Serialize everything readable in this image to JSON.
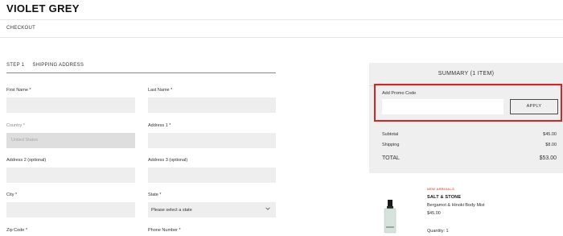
{
  "header": {
    "logo": "VIOLET GREY"
  },
  "subheader": {
    "label": "CHECKOUT"
  },
  "step": {
    "number": "STEP 1",
    "title": "SHIPPING ADDRESS"
  },
  "form": {
    "first_name_label": "First Name *",
    "last_name_label": "Last Name *",
    "country_label": "Country *",
    "country_value": "United States",
    "address1_label": "Address 1 *",
    "address2_label": "Address 2 (optional)",
    "address3_label": "Address 3 (optional)",
    "city_label": "City *",
    "state_label": "State *",
    "state_value": "Please select a state",
    "zip_label": "Zip Code *",
    "phone_label": "Phone Number *"
  },
  "summary": {
    "title": "SUMMARY (1 ITEM)",
    "promo_label": "Add Promo Code",
    "promo_value": "",
    "apply_label": "APPLY",
    "subtotal_label": "Subtotal",
    "subtotal_value": "$45.00",
    "shipping_label": "Shipping",
    "shipping_value": "$8.00",
    "total_label": "TOTAL",
    "total_value": "$53.00"
  },
  "product": {
    "badge": "NEW ARRIVALS",
    "brand": "SALT & STONE",
    "name": "Bergamot & Hinoki Body Mist",
    "price": "$45.00",
    "quantity": "Quantity: 1",
    "icon": "bottle-icon"
  },
  "colors": {
    "accent_red": "#d92323",
    "field_bg": "#eeeeee",
    "summary_bg": "#efefef",
    "badge": "#e0664a"
  }
}
